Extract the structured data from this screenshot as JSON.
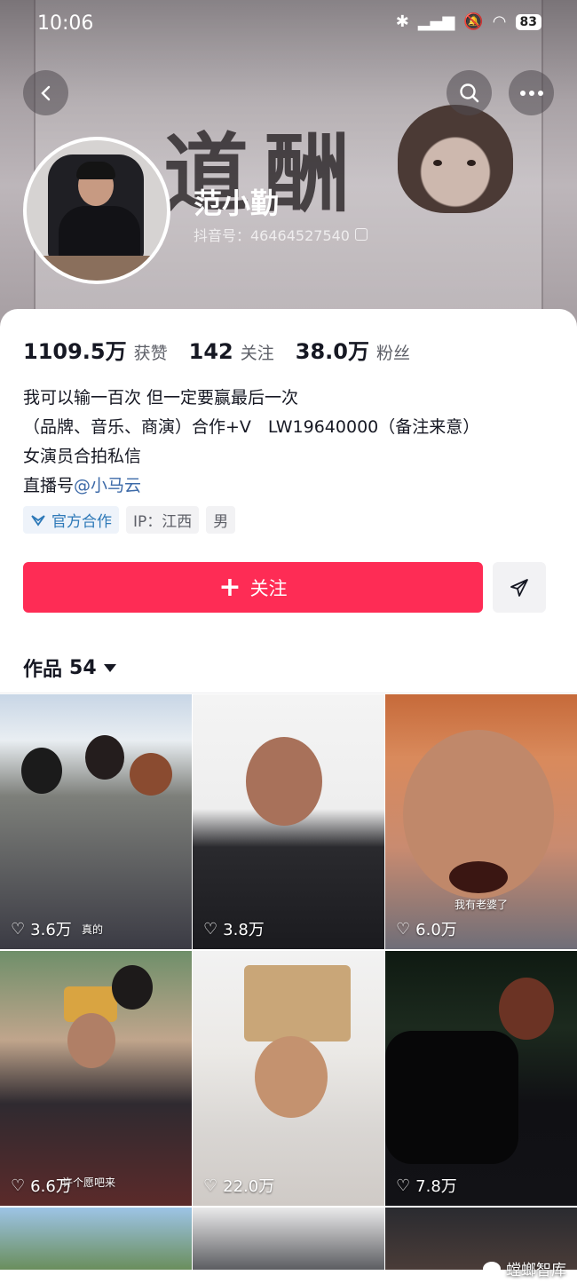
{
  "status_bar": {
    "time": "10:06",
    "battery": "83"
  },
  "profile": {
    "name": "范小勤",
    "douyin_id": "抖音号：46464527540",
    "banner_text": "一道酬"
  },
  "stats": [
    {
      "value": "1109.5万",
      "label": "获赞"
    },
    {
      "value": "142",
      "label": "关注"
    },
    {
      "value": "38.0万",
      "label": "粉丝"
    }
  ],
  "bio": {
    "line1": "我可以输一百次 但一定要赢最后一次",
    "line2": "（品牌、音乐、商演）合作+V　LW19640000（备注来意）",
    "line3": "女演员合拍私信",
    "line4_prefix": "直播号",
    "line4_mention": "@小马云"
  },
  "tags": {
    "official": "官方合作",
    "ip": "IP：江西",
    "gender": "男"
  },
  "actions": {
    "follow": "关注"
  },
  "works": {
    "label": "作品",
    "count": "54"
  },
  "videos": [
    {
      "likes": "3.6万",
      "caption": "真的"
    },
    {
      "likes": "3.8万",
      "caption": ""
    },
    {
      "likes": "6.0万",
      "caption": "我有老婆了"
    },
    {
      "likes": "6.6万",
      "caption": "许个愿吧来"
    },
    {
      "likes": "22.0万",
      "caption": ""
    },
    {
      "likes": "7.8万",
      "caption": ""
    }
  ],
  "watermark": "螳螂智库",
  "colors": {
    "accent": "#fe2c55",
    "mention": "#3d6aa8",
    "official": "#2e79b8"
  }
}
